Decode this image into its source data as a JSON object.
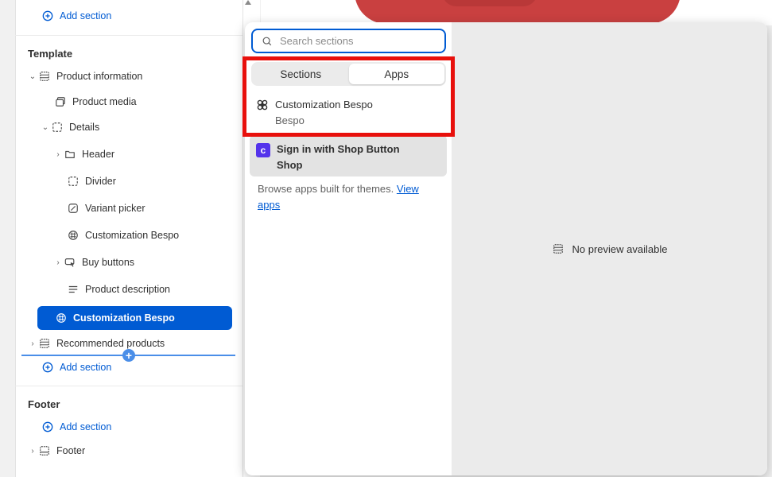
{
  "sidebar": {
    "add_section_top": "Add section",
    "template_title": "Template",
    "items": {
      "product_information": "Product information",
      "product_media": "Product media",
      "details": "Details",
      "header": "Header",
      "divider": "Divider",
      "variant_picker": "Variant picker",
      "customization_bespo": "Customization Bespo",
      "buy_buttons": "Buy buttons",
      "product_description": "Product description",
      "customization_bespo_selected": "Customization Bespo",
      "recommended_products": "Recommended products"
    },
    "add_section_template": "Add section",
    "footer_title": "Footer",
    "add_section_footer": "Add section",
    "footer_item": "Footer"
  },
  "popover": {
    "search_placeholder": "Search sections",
    "tabs": [
      {
        "label": "Sections",
        "active": false
      },
      {
        "label": "Apps",
        "active": true
      }
    ],
    "apps": [
      {
        "name": "Customization Bespo",
        "vendor": "Bespo",
        "icon": "bespo-icon"
      },
      {
        "name": "Sign in with Shop Button",
        "vendor": "Shop",
        "icon": "shop-icon"
      }
    ],
    "browse_text": "Browse apps built for themes.",
    "browse_link": "View apps",
    "preview_text": "No preview available"
  },
  "colors": {
    "accent": "#005bd3",
    "highlight": "#e8100c",
    "shop_brand": "#5433eb"
  }
}
